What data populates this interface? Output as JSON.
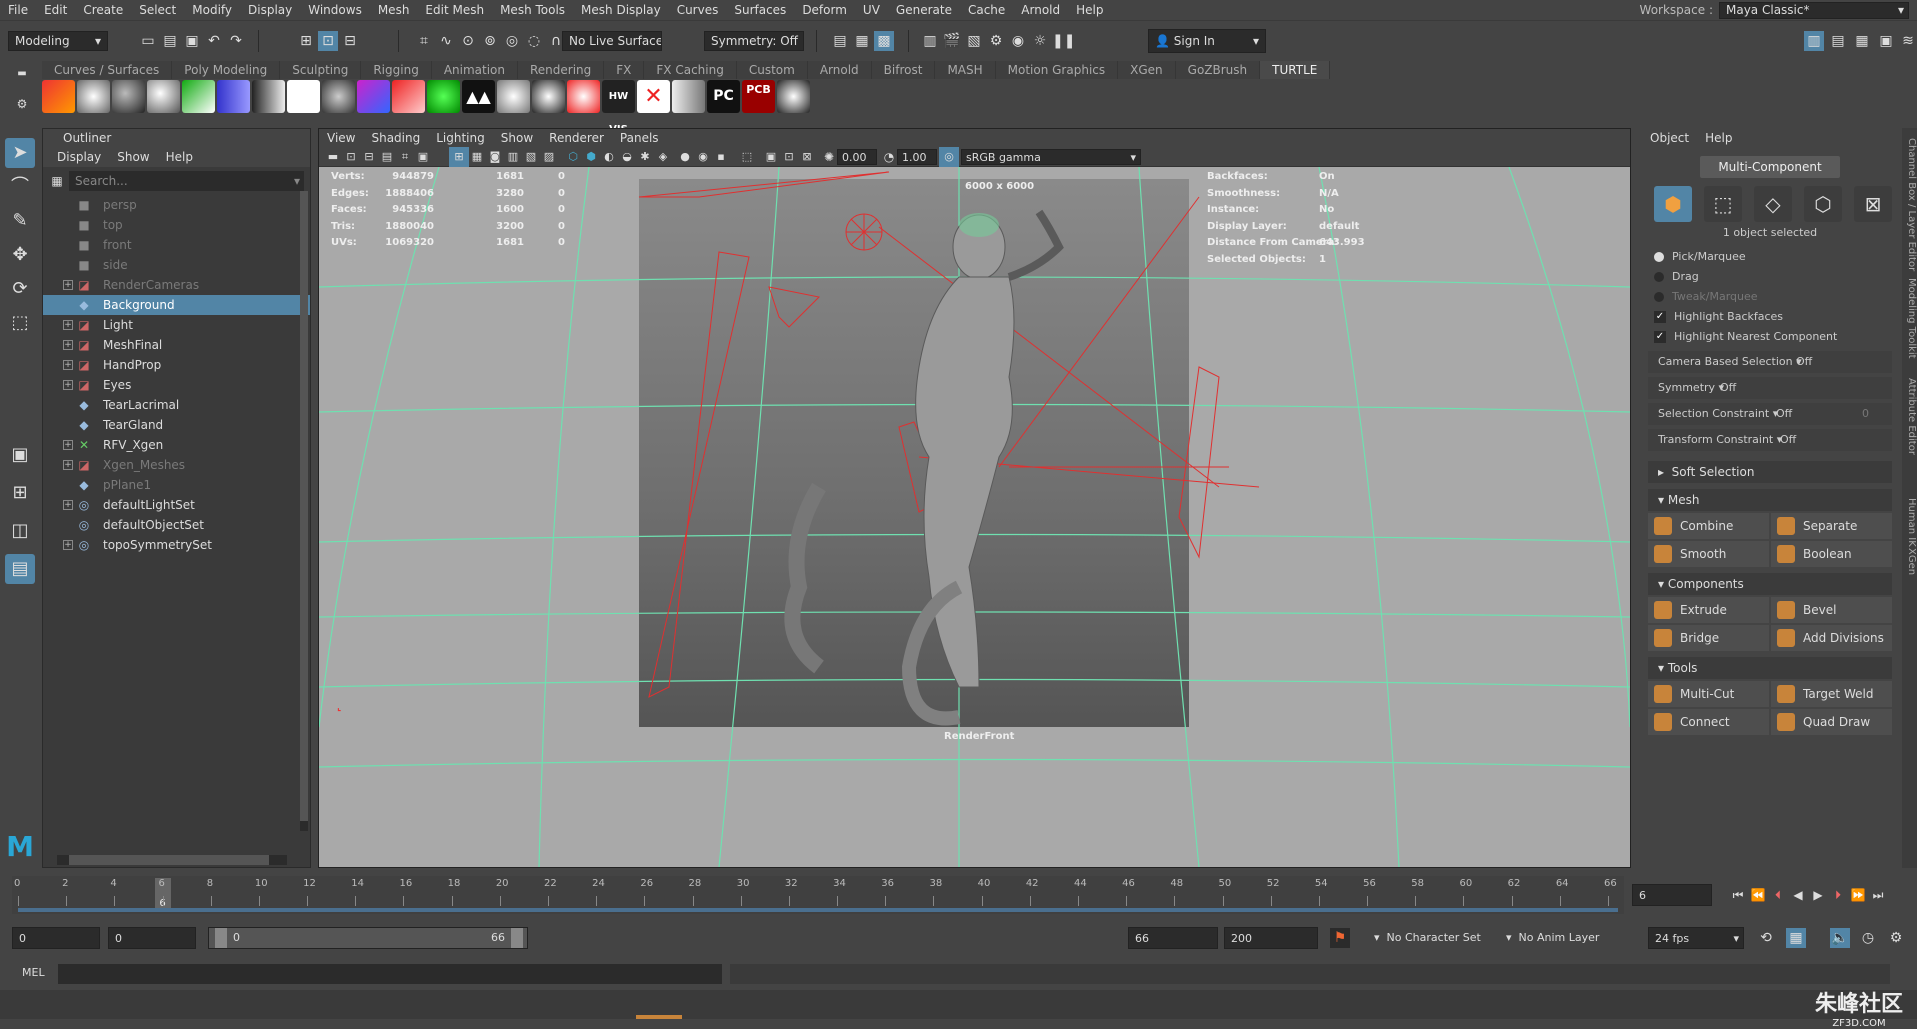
{
  "menubar": [
    "File",
    "Edit",
    "Create",
    "Select",
    "Modify",
    "Display",
    "Windows",
    "Mesh",
    "Edit Mesh",
    "Mesh Tools",
    "Mesh Display",
    "Curves",
    "Surfaces",
    "Deform",
    "UV",
    "Generate",
    "Cache",
    "Arnold",
    "Help"
  ],
  "workspace": {
    "label": "Workspace :",
    "value": "Maya Classic*"
  },
  "toolbar": {
    "mode": "Modeling",
    "live_surface": "No Live Surface",
    "symmetry": "Symmetry: Off",
    "sign_in": "Sign In"
  },
  "shelf_tabs": [
    "Curves / Surfaces",
    "Poly Modeling",
    "Sculpting",
    "Rigging",
    "Animation",
    "Rendering",
    "FX",
    "FX Caching",
    "Custom",
    "Arnold",
    "Bifrost",
    "MASH",
    "Motion Graphics",
    "XGen",
    "GoZBrush",
    "TURTLE"
  ],
  "shelf_active": "TURTLE",
  "shelf_icon_labels": {
    "hw": "HW VIS",
    "pc": "PC",
    "pcb": "PCB"
  },
  "outliner": {
    "title": "Outliner",
    "menu": [
      "Display",
      "Show",
      "Help"
    ],
    "search_placeholder": "Search...",
    "items": [
      {
        "name": "persp",
        "expand": false,
        "dim": true,
        "icon": "camera"
      },
      {
        "name": "top",
        "expand": false,
        "dim": true,
        "icon": "camera"
      },
      {
        "name": "front",
        "expand": false,
        "dim": true,
        "icon": "camera"
      },
      {
        "name": "side",
        "expand": false,
        "dim": true,
        "icon": "camera"
      },
      {
        "name": "RenderCameras",
        "expand": true,
        "dim": true,
        "icon": "group"
      },
      {
        "name": "Background",
        "expand": false,
        "dim": false,
        "icon": "mesh",
        "selected": true
      },
      {
        "name": "Light",
        "expand": true,
        "dim": false,
        "icon": "group"
      },
      {
        "name": "MeshFinal",
        "expand": true,
        "dim": false,
        "icon": "group"
      },
      {
        "name": "HandProp",
        "expand": true,
        "dim": false,
        "icon": "group"
      },
      {
        "name": "Eyes",
        "expand": true,
        "dim": false,
        "icon": "group"
      },
      {
        "name": "TearLacrimal",
        "expand": false,
        "dim": false,
        "icon": "mesh"
      },
      {
        "name": "TearGland",
        "expand": false,
        "dim": false,
        "icon": "mesh"
      },
      {
        "name": "RFV_Xgen",
        "expand": true,
        "dim": false,
        "icon": "xgen"
      },
      {
        "name": "Xgen_Meshes",
        "expand": true,
        "dim": true,
        "icon": "group"
      },
      {
        "name": "pPlane1",
        "expand": false,
        "dim": true,
        "icon": "mesh"
      },
      {
        "name": "defaultLightSet",
        "expand": true,
        "dim": false,
        "icon": "set"
      },
      {
        "name": "defaultObjectSet",
        "expand": false,
        "dim": false,
        "icon": "set"
      },
      {
        "name": "topoSymmetrySet",
        "expand": true,
        "dim": false,
        "icon": "set"
      }
    ]
  },
  "viewport": {
    "menu": [
      "View",
      "Shading",
      "Lighting",
      "Show",
      "Renderer",
      "Panels"
    ],
    "exposure": "0.00",
    "gamma": "1.00",
    "color_space": "sRGB gamma",
    "resolution": "6000 x 6000",
    "camera": "RenderFront",
    "stats": [
      {
        "label": "Verts:",
        "a": "944879",
        "b": "1681",
        "c": "0"
      },
      {
        "label": "Edges:",
        "a": "1888406",
        "b": "3280",
        "c": "0"
      },
      {
        "label": "Faces:",
        "a": "945336",
        "b": "1600",
        "c": "0"
      },
      {
        "label": "Tris:",
        "a": "1880040",
        "b": "3200",
        "c": "0"
      },
      {
        "label": "UVs:",
        "a": "1069320",
        "b": "1681",
        "c": "0"
      }
    ],
    "info": [
      {
        "label": "Backfaces:",
        "value": "On"
      },
      {
        "label": "Smoothness:",
        "value": "N/A"
      },
      {
        "label": "Instance:",
        "value": "No"
      },
      {
        "label": "Display Layer:",
        "value": "default"
      },
      {
        "label": "Distance From Camera:",
        "value": "643.993"
      },
      {
        "label": "Selected Objects:",
        "value": "1"
      }
    ]
  },
  "modeling_toolkit": {
    "menu": [
      "Object",
      "Help"
    ],
    "mode_button": "Multi-Component",
    "selected_text": "1 object selected",
    "pick_marquee": "Pick/Marquee",
    "drag": "Drag",
    "tweak_marquee": "Tweak/Marquee",
    "highlight_backfaces": "Highlight Backfaces",
    "highlight_nearest": "Highlight Nearest Component",
    "camera_based": {
      "label": "Camera Based Selection",
      "value": "Off"
    },
    "symmetry": {
      "label": "Symmetry",
      "value": "Off"
    },
    "selection_constraint": {
      "label": "Selection Constraint",
      "value": "Off",
      "num": "0"
    },
    "transform_constraint": {
      "label": "Transform Constraint",
      "value": "Off"
    },
    "soft_selection": "Soft Selection",
    "sections": [
      {
        "title": "Mesh",
        "buttons": [
          "Combine",
          "Separate",
          "Smooth",
          "Boolean"
        ]
      },
      {
        "title": "Components",
        "buttons": [
          "Extrude",
          "Bevel",
          "Bridge",
          "Add Divisions"
        ]
      },
      {
        "title": "Tools",
        "buttons": [
          "Multi-Cut",
          "Target Weld",
          "Connect",
          "Quad Draw"
        ]
      }
    ]
  },
  "side_tabs": [
    "Channel Box / Layer Editor",
    "Modeling Toolkit",
    "Attribute Editor",
    "Human IK",
    "XGen"
  ],
  "timeline": {
    "ticks": [
      "0",
      "2",
      "4",
      "6",
      "8",
      "10",
      "12",
      "14",
      "16",
      "18",
      "20",
      "22",
      "24",
      "26",
      "28",
      "30",
      "32",
      "34",
      "36",
      "38",
      "40",
      "42",
      "44",
      "46",
      "48",
      "50",
      "52",
      "54",
      "56",
      "58",
      "60",
      "62",
      "64",
      "66"
    ],
    "current": "6",
    "current_field": "6"
  },
  "range": {
    "start": "0",
    "anim_start": "0",
    "slider_start": "0",
    "slider_end": "66",
    "end": "66",
    "anim_end": "200",
    "character_set": "No Character Set",
    "anim_layer": "No Anim Layer",
    "fps": "24 fps"
  },
  "command": {
    "label": "MEL"
  },
  "watermark": {
    "cn": "朱峰社区",
    "url": "ZF3D.COM"
  },
  "colors": {
    "accent": "#5285a6",
    "wire_green": "#6fe0b0",
    "wire_red": "#e03030"
  }
}
